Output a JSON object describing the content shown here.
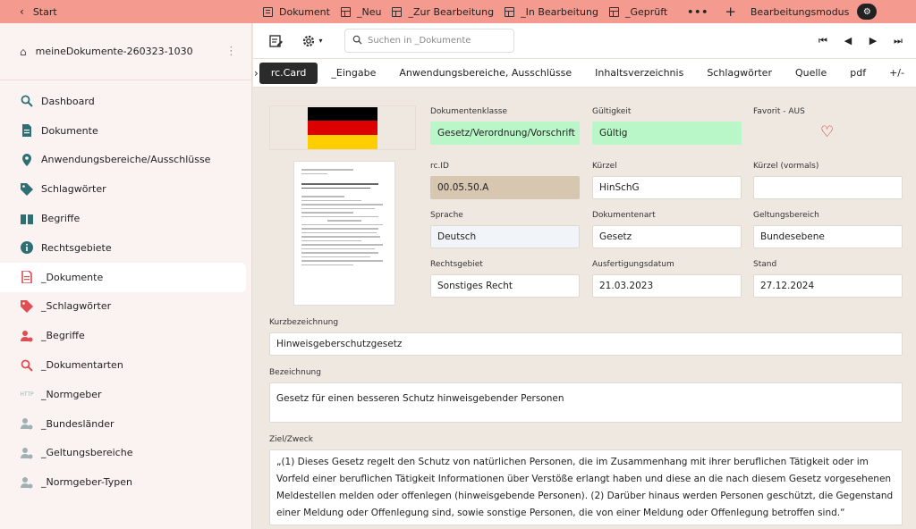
{
  "topbar": {
    "start": "Start",
    "tabs": [
      {
        "label": "Dokument",
        "icon": "doc"
      },
      {
        "label": "_Neu",
        "icon": "grid"
      },
      {
        "label": "_Zur Bearbeitung",
        "icon": "grid"
      },
      {
        "label": "_In Bearbeitung",
        "icon": "grid"
      },
      {
        "label": "_Geprüft",
        "icon": "grid"
      }
    ],
    "more": "•••",
    "plus": "+",
    "mode_label": "Bearbeitungsmodus"
  },
  "sidebar": {
    "title": "meineDokumente-260323-1030",
    "items": [
      {
        "label": "Dashboard",
        "icon": "search-icon"
      },
      {
        "label": "Dokumente",
        "icon": "document-icon"
      },
      {
        "label": "Anwendungsbereiche/Ausschlüsse",
        "icon": "location-pin-icon"
      },
      {
        "label": "Schlagwörter",
        "icon": "tag-icon"
      },
      {
        "label": "Begriffe",
        "icon": "book-icon"
      },
      {
        "label": "Rechtsgebiete",
        "icon": "info-icon"
      },
      {
        "label": "_Dokumente",
        "icon": "document-icon"
      },
      {
        "label": "_Schlagwörter",
        "icon": "tag-icon"
      },
      {
        "label": "_Begriffe",
        "icon": "users-icon"
      },
      {
        "label": "_Dokumentarten",
        "icon": "search-icon"
      },
      {
        "label": "_Normgeber",
        "icon": "http-icon"
      },
      {
        "label": "_Bundesländer",
        "icon": "users-icon"
      },
      {
        "label": "_Geltungsbereiche",
        "icon": "users-icon"
      },
      {
        "label": "_Normgeber-Typen",
        "icon": "users-icon"
      }
    ],
    "active_index": 6
  },
  "toolbar": {
    "search_placeholder": "Suchen in _Dokumente"
  },
  "subtabs": [
    "rc.Card",
    "_Eingabe",
    "Anwendungsbereiche, Ausschlüsse",
    "Inhaltsverzeichnis",
    "Schlagwörter",
    "Quelle",
    "pdf",
    "+/-"
  ],
  "form": {
    "dokumentenklasse": {
      "label": "Dokumentenklasse",
      "value": "Gesetz/Verordnung/Vorschrift"
    },
    "gueltigkeit": {
      "label": "Gültigkeit",
      "value": "Gültig"
    },
    "favorit": {
      "label": "Favorit - AUS"
    },
    "rcid": {
      "label": "rc.ID",
      "value": "00.05.50.A"
    },
    "kuerzel": {
      "label": "Kürzel",
      "value": "HinSchG"
    },
    "kuerzel_vormals": {
      "label": "Kürzel (vormals)",
      "value": ""
    },
    "sprache": {
      "label": "Sprache",
      "value": "Deutsch"
    },
    "dokumentenart": {
      "label": "Dokumentenart",
      "value": "Gesetz"
    },
    "geltungsbereich": {
      "label": "Geltungsbereich",
      "value": "Bundesebene"
    },
    "rechtsgebiet": {
      "label": "Rechtsgebiet",
      "value": "Sonstiges Recht"
    },
    "ausfertigungsdatum": {
      "label": "Ausfertigungsdatum",
      "value": "21.03.2023"
    },
    "stand": {
      "label": "Stand",
      "value": "27.12.2024"
    },
    "kurzbezeichnung": {
      "label": "Kurzbezeichnung",
      "value": "Hinweisgeberschutzgesetz"
    },
    "bezeichnung": {
      "label": "Bezeichnung",
      "value": "Gesetz für einen besseren Schutz hinweisgebender Personen"
    },
    "zielzweck": {
      "label": "Ziel/Zweck",
      "value": "„(1) Dieses Gesetz regelt den Schutz von natürlichen Personen, die im Zusammenhang mit ihrer beruflichen Tätigkeit oder im Vorfeld einer beruflichen Tätigkeit Informationen über Verstöße erlangt haben und diese an die nach diesem Gesetz vorgesehenen Meldestellen melden oder offenlegen (hinweisgebende Personen). (2) Darüber hinaus werden Personen geschützt, die Gegenstand einer Meldung oder Offenlegung sind, sowie sonstige Personen, die von einer Meldung oder Offenlegung betroffen sind.“"
    }
  },
  "colors": {
    "topbar": "#f59a8e",
    "flag_black": "#000000",
    "flag_red": "#dd0000",
    "flag_gold": "#ffce00"
  }
}
